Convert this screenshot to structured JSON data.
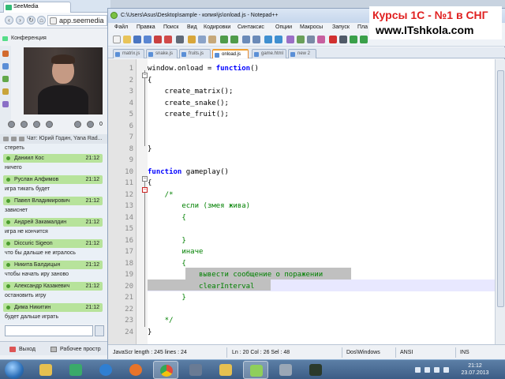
{
  "browser": {
    "tab_title": "SeeMedia",
    "url": "app.seemedia",
    "conference_label": "Конференция",
    "video_counts": "0",
    "chat_header": "Чат: Юрий Годин, Yana Rad...",
    "prev_message": "стереть",
    "messages": [
      {
        "name": "Даниил Кос",
        "time": "21:12",
        "text": "ничего"
      },
      {
        "name": "Руслан Алфимов",
        "time": "21:12",
        "text": "игра тикать будет"
      },
      {
        "name": "Павел Владимирович",
        "time": "21:12",
        "text": "зависнет"
      },
      {
        "name": "Андрей Закамалдин",
        "time": "21:12",
        "text": "игра не кончится"
      },
      {
        "name": "Diccuric Sigeon",
        "time": "21:12",
        "text": "что бы дальше не игралось"
      },
      {
        "name": "Никита Балдицын",
        "time": "21:12",
        "text": "чтобы начать иру заново"
      },
      {
        "name": "Александр Казакевич",
        "time": "21:12",
        "text": "остановить игру"
      },
      {
        "name": "Дима Никитин",
        "time": "21:12",
        "text": "будет дальше играть"
      }
    ],
    "exit_label": "Выход",
    "workspace_label": "Рабочее простр"
  },
  "npp": {
    "title": "C:\\Users\\Asus\\Desktop\\sample - копия\\js\\onload.js - Notepad++",
    "menu": [
      "Файл",
      "Правка",
      "Поиск",
      "Вид",
      "Кодировки",
      "Синтаксис",
      "Опции",
      "Макросы",
      "Запуск",
      "Пла"
    ],
    "tabs": [
      "matrix.js",
      "snake.js",
      "fruits.js",
      "onload.js",
      "game.html",
      "new 2"
    ],
    "active_tab": 3,
    "lines": [
      "window.onload = function()",
      "{",
      "    create_matrix();",
      "    create_snake();",
      "    create_fruit();",
      "",
      "",
      "}",
      "",
      "function gameplay()",
      "{",
      "    /*",
      "        если (змея жива)",
      "        {",
      "",
      "        }",
      "        иначе",
      "        {",
      "            вывести сообщение о поражении",
      "            clearInterval",
      "        }",
      "",
      "    */",
      "}"
    ],
    "line_numbers": [
      "1",
      "2",
      "3",
      "4",
      "5",
      "6",
      "7",
      "8",
      "9",
      "10",
      "11",
      "12",
      "13",
      "14",
      "15",
      "16",
      "17",
      "18",
      "19",
      "20",
      "21",
      "22",
      "23",
      "24"
    ],
    "status": {
      "type": "JavaScr length : 245   lines : 24",
      "position": "Ln : 20    Col : 26    Sel : 48",
      "eol": "Dos\\Windows",
      "encoding": "ANSI",
      "mode": "INS"
    }
  },
  "watermark": {
    "line1": "Курсы 1С - №1 в СНГ",
    "line2": "www.ITshkola.com"
  },
  "taskbar": {
    "time": "21:12",
    "date": "23.07.2013"
  },
  "colors": {
    "keyword": "#0000ff",
    "comment": "#008000",
    "selection": "#c0c0c0",
    "chat_header_green": "#b7e39b",
    "watermark_red": "#e02020"
  }
}
